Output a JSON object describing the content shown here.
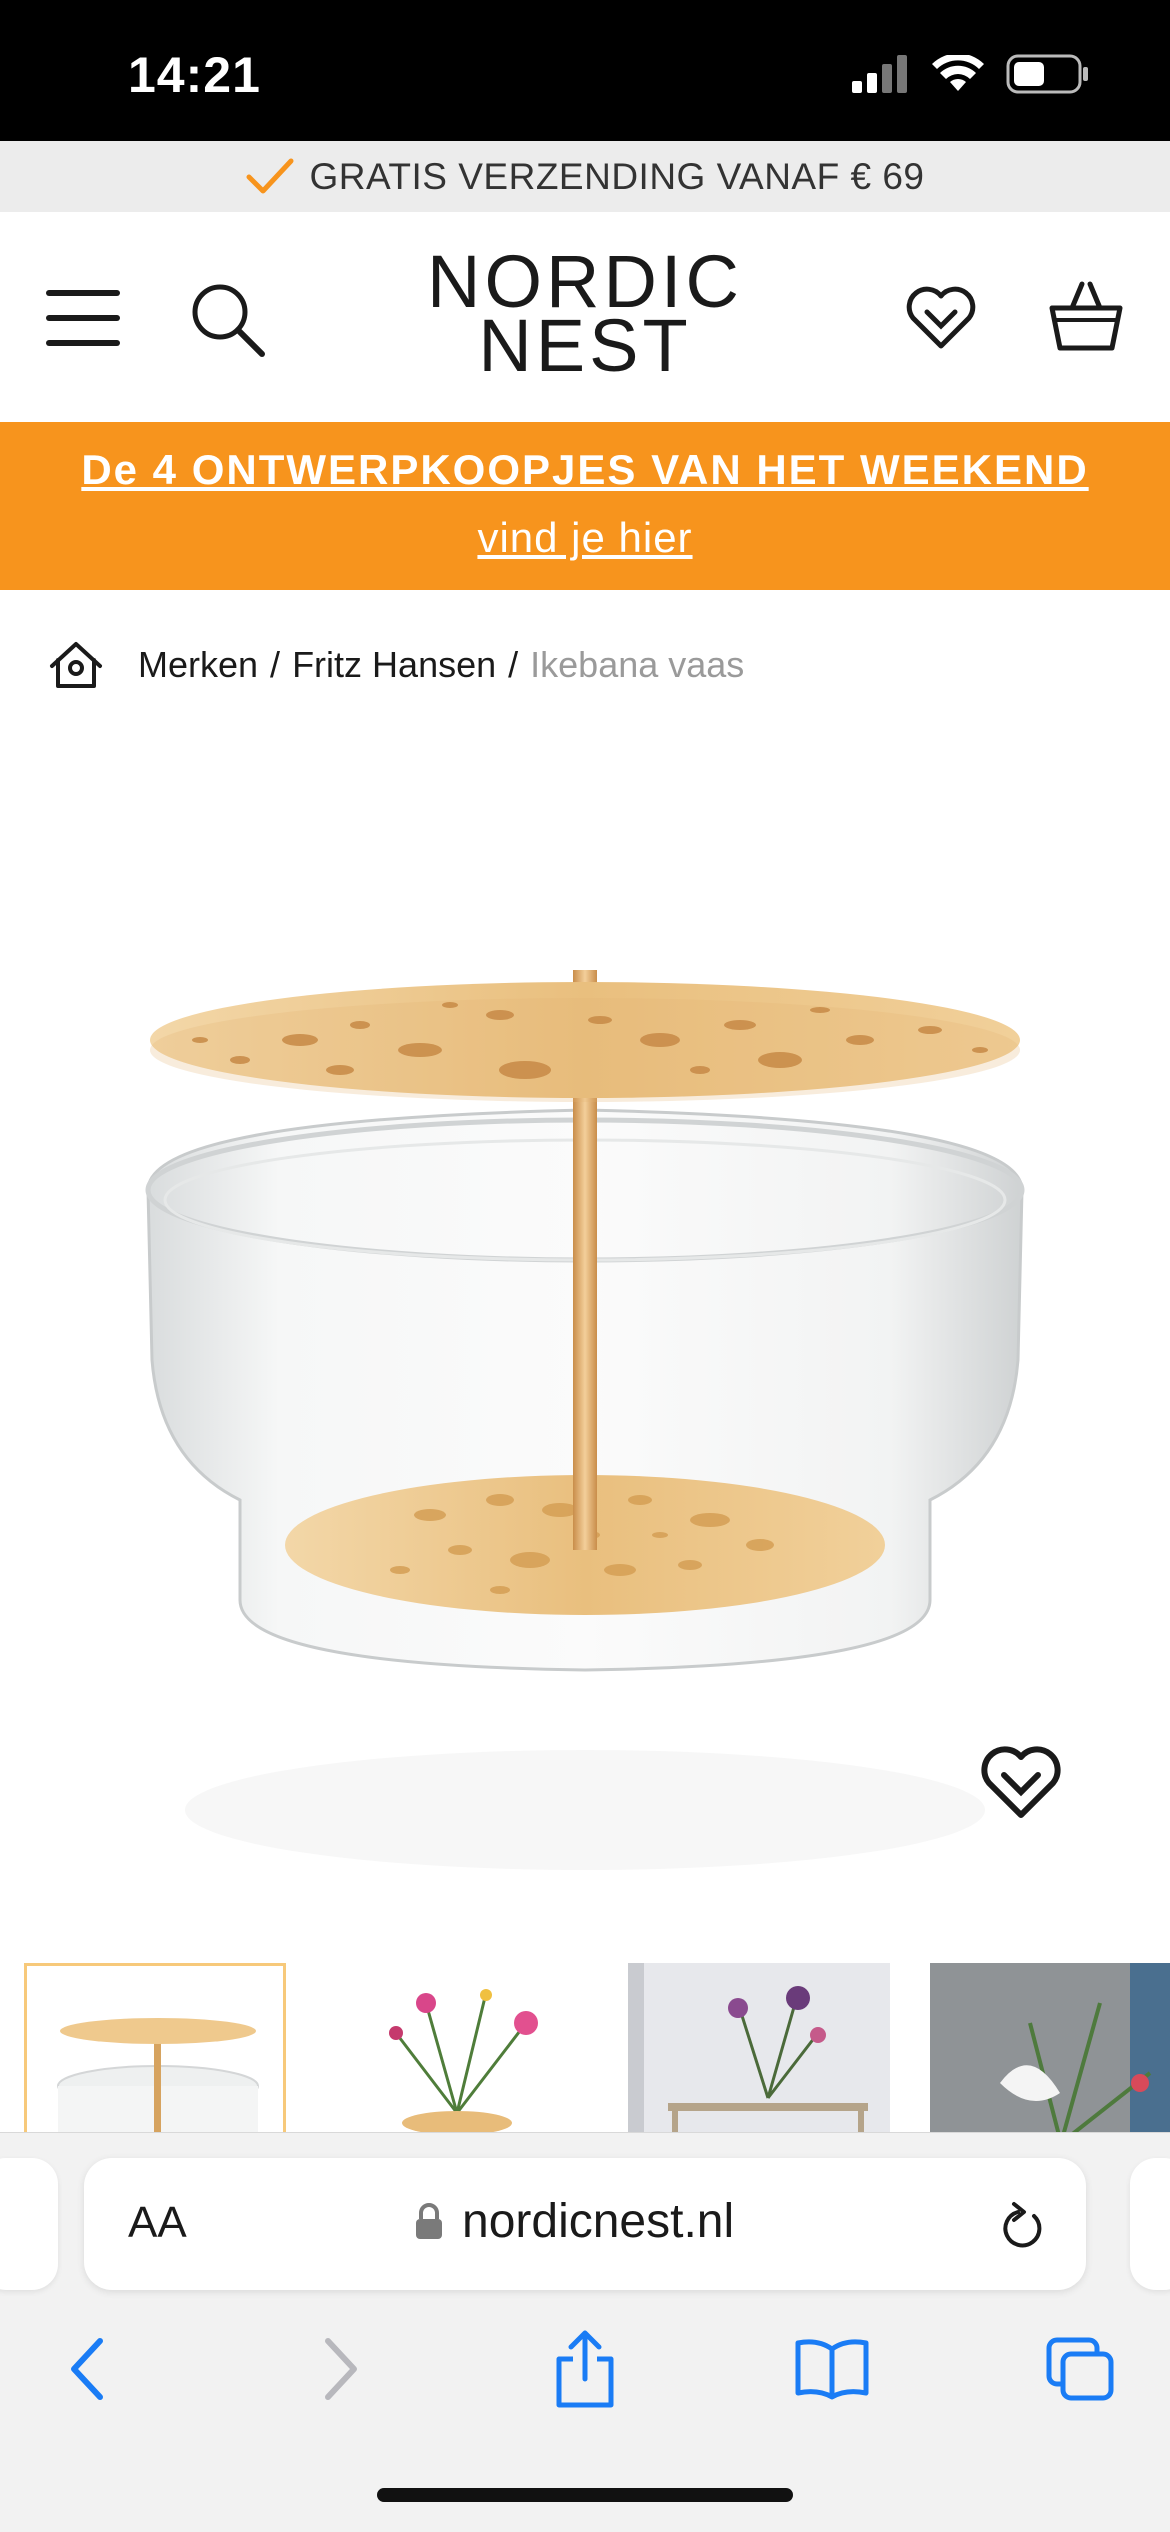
{
  "status_bar": {
    "time": "14:21"
  },
  "shipping": {
    "text": "GRATIS VERZENDING VANAF € 69",
    "icon": "checkmark-icon"
  },
  "header": {
    "logo_line1": "NORDIC",
    "logo_line2": "NEST",
    "icons": [
      "menu-icon",
      "search-icon",
      "wishlist-heart-icon",
      "basket-icon"
    ]
  },
  "promo": {
    "line1": "De 4 ONTWERPKOOPJES VAN HET WEEKEND",
    "line2": "vind je hier",
    "color": "#f7941d"
  },
  "breadcrumb": {
    "items": [
      "Merken",
      "Fritz Hansen"
    ],
    "separator": "/",
    "current": "Ikebana vaas"
  },
  "product": {
    "image_icon": "ikebana-vase-image",
    "wishlist_icon": "heart-icon"
  },
  "thumbnails": [
    {
      "name": "thumbnail-vase",
      "active": true
    },
    {
      "name": "thumbnail-flowers",
      "active": false
    },
    {
      "name": "thumbnail-shelf",
      "active": false
    },
    {
      "name": "thumbnail-anthurium",
      "active": false
    }
  ],
  "browser": {
    "text_size_label": "AA",
    "url": "nordicnest.nl",
    "accent_color": "#1a7cf5"
  }
}
